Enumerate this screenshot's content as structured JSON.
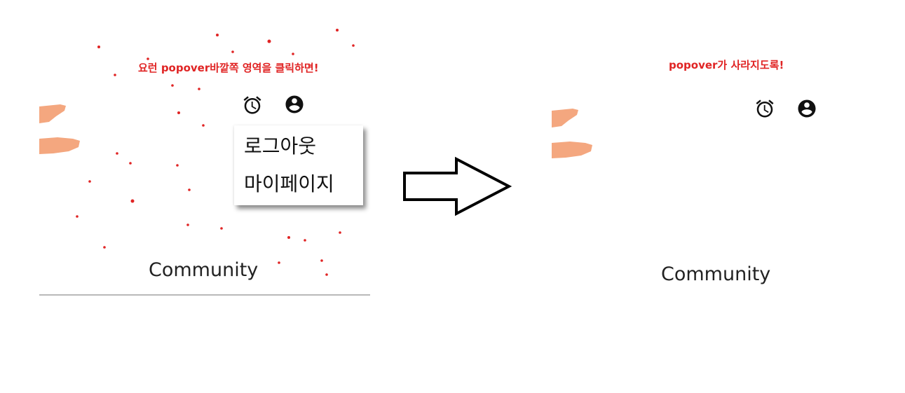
{
  "left": {
    "annotation": "요런 popover바깥쪽 영역을 클릭하면!",
    "header": {
      "alarm_icon": "alarm-clock-icon",
      "account_icon": "account-circle-icon"
    },
    "popover": {
      "items": [
        {
          "label": "로그아웃"
        },
        {
          "label": "마이페이지"
        }
      ]
    },
    "nav_label": "Community"
  },
  "right": {
    "annotation": "popover가 사라지도록!",
    "header": {
      "alarm_icon": "alarm-clock-icon",
      "account_icon": "account-circle-icon"
    },
    "nav_label": "Community"
  },
  "colors": {
    "annotation": "#e02424",
    "brush": "#f4a77f",
    "divider": "#b9b9b9"
  }
}
